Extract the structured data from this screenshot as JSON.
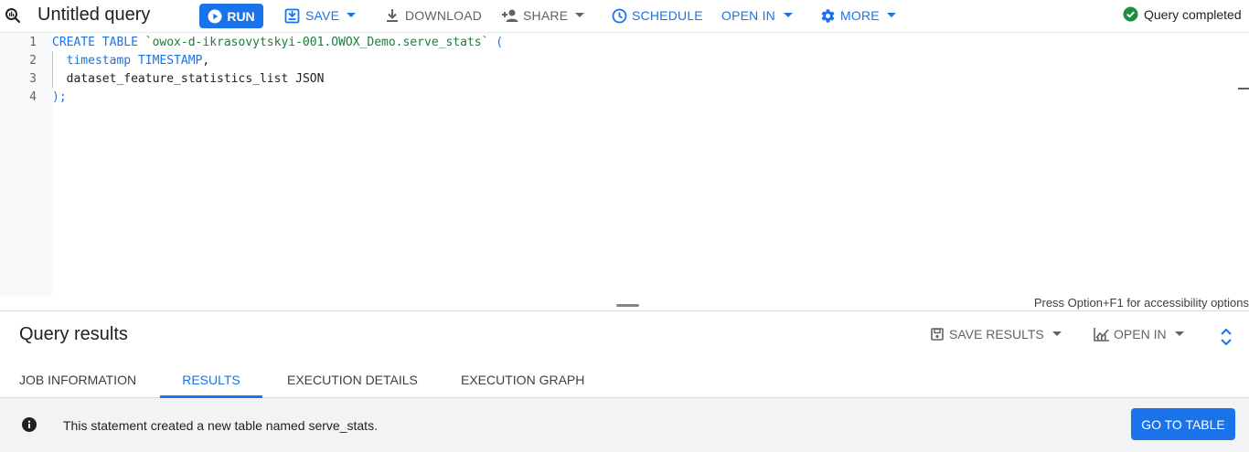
{
  "toolbar": {
    "title": "Untitled query",
    "run_label": "RUN",
    "save_label": "SAVE",
    "download_label": "DOWNLOAD",
    "share_label": "SHARE",
    "schedule_label": "SCHEDULE",
    "open_in_label": "OPEN IN",
    "more_label": "MORE",
    "status_text": "Query completed"
  },
  "editor": {
    "line_numbers": [
      "1",
      "2",
      "3",
      "4"
    ],
    "lines": [
      {
        "kw1": "CREATE TABLE",
        "str": "`owox-d-ikrasovytskyi-001.OWOX_Demo.serve_stats`",
        "punct": "("
      },
      {
        "name": "timestamp",
        "type": "TIMESTAMP",
        "punct": ","
      },
      {
        "name": "dataset_feature_statistics_list",
        "type": "JSON"
      },
      {
        "punct": ");"
      }
    ],
    "accessibility_hint": "Press Option+F1 for accessibility options"
  },
  "results": {
    "title": "Query results",
    "save_results_label": "SAVE RESULTS",
    "open_in_label": "OPEN IN",
    "tabs": [
      {
        "label": "JOB INFORMATION",
        "active": false
      },
      {
        "label": "RESULTS",
        "active": true
      },
      {
        "label": "EXECUTION DETAILS",
        "active": false
      },
      {
        "label": "EXECUTION GRAPH",
        "active": false
      }
    ],
    "message": "This statement created a new table named serve_stats.",
    "go_to_table_label": "GO TO TABLE"
  },
  "colors": {
    "accent": "#1a73e8",
    "success": "#1e8e3e",
    "string": "#188038",
    "infobar_bg": "#f1f3f4"
  },
  "icons": [
    "query-icon",
    "play-icon",
    "save-icon",
    "download-icon",
    "person-add-icon",
    "schedule-icon",
    "gear-icon",
    "check-circle-icon",
    "chevron-down-icon",
    "save-results-icon",
    "chart-icon",
    "expand-icon",
    "info-icon"
  ]
}
